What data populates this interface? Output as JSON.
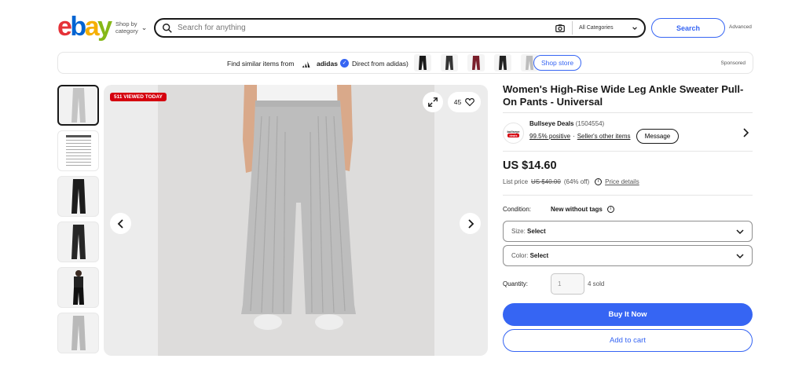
{
  "header": {
    "logo": {
      "letters": [
        "e",
        "b",
        "a",
        "y"
      ],
      "colors": [
        "#e53238",
        "#0064d2",
        "#f5af02",
        "#86b817"
      ]
    },
    "shop_by_line1": "Shop by",
    "shop_by_line2": "category",
    "search_placeholder": "Search for anything",
    "category_select": "All Categories",
    "search_button": "Search",
    "advanced_link": "Advanced"
  },
  "promo": {
    "find_similar": "Find similar items from",
    "brand": "adidas",
    "direct": "Direct from adidas)",
    "shop_store": "Shop store",
    "sponsored": "Sponsored",
    "thumb_colors": [
      "#1a1a1a",
      "#333333",
      "#7a1f2b",
      "#222222",
      "#bcbcbc"
    ]
  },
  "gallery": {
    "viewed_badge": "511 VIEWED TODAY",
    "watch_count": "45",
    "thumbnails": [
      {
        "kind": "grey-pants"
      },
      {
        "kind": "size-chart"
      },
      {
        "kind": "black-pants"
      },
      {
        "kind": "black-pants"
      },
      {
        "kind": "model-black"
      },
      {
        "kind": "grey-pants"
      }
    ]
  },
  "listing": {
    "title": "Women's High-Rise Wide Leg Ankle Sweater Pull-On Pants - Universal",
    "seller": {
      "logo_line1": "bullseye",
      "logo_line2": "deals",
      "name": "Bullseye Deals",
      "feedback_count": "(1504554)",
      "positive": "99.5% positive",
      "separator": "·",
      "other_items": "Seller's other items",
      "message_button": "Message"
    },
    "price": "US $14.60",
    "list_price_label": "List price",
    "list_price": "US $40.00",
    "discount": "(64% off)",
    "price_details": "Price details",
    "condition_label": "Condition:",
    "condition_value": "New without tags",
    "size_label": "Size:",
    "size_value": "Select",
    "color_label": "Color:",
    "color_value": "Select",
    "quantity_label": "Quantity:",
    "quantity_value": "1",
    "sold": "4 sold",
    "buy_now": "Buy It Now",
    "add_to_cart": "Add to cart"
  },
  "icons": [
    "search-icon",
    "camera-icon",
    "chevron-down-icon",
    "adidas-logo-icon",
    "verified-icon",
    "expand-icon",
    "heart-icon",
    "chevron-left-icon",
    "chevron-right-icon",
    "info-icon"
  ],
  "colors": {
    "accent": "#3665f3",
    "badge_red": "#d5000e",
    "text": "#191919"
  }
}
